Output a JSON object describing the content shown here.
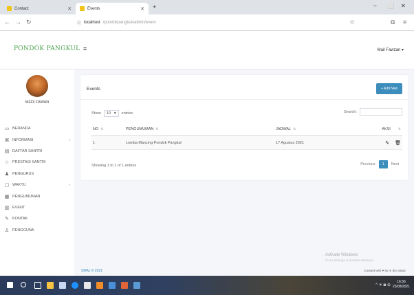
{
  "browser": {
    "tabs": [
      {
        "label": "Contact",
        "active": false
      },
      {
        "label": "Events",
        "active": true
      }
    ],
    "new_tab": "+",
    "url_host": "localhost",
    "url_path": "/pondokpangkul/admin/event",
    "window_controls": {
      "minimize": "–",
      "maximize": "⬜",
      "close": "✕"
    }
  },
  "header": {
    "brand": "PONDOK PANGKUL",
    "user_menu": "Mail Fawzan ▾"
  },
  "sidebar": {
    "user_name": "MEDI FAWAN",
    "items": [
      {
        "icon": "desktop-icon",
        "glyph": "▭",
        "label": "BERANDA",
        "chevron": ""
      },
      {
        "icon": "sitemap-icon",
        "glyph": "⌘",
        "label": "INFORMASI",
        "chevron": "‹"
      },
      {
        "icon": "document-icon",
        "glyph": "▤",
        "label": "DAFTAR SANTRI",
        "chevron": ""
      },
      {
        "icon": "star-icon",
        "glyph": "☆",
        "label": "PRESTASI SANTRI",
        "chevron": ""
      },
      {
        "icon": "users-icon",
        "glyph": "♟",
        "label": "PENGURUS",
        "chevron": ""
      },
      {
        "icon": "book-icon",
        "glyph": "▢",
        "label": "WAKTU",
        "chevron": "‹"
      },
      {
        "icon": "newspaper-icon",
        "glyph": "▦",
        "label": "PENGUMUMAN",
        "chevron": ""
      },
      {
        "icon": "calendar-icon",
        "glyph": "▥",
        "label": "EVENT",
        "chevron": ""
      },
      {
        "icon": "pen-icon",
        "glyph": "✎",
        "label": "KONTAK",
        "chevron": ""
      },
      {
        "icon": "user-icon",
        "glyph": "♙",
        "label": "PENGGUNA",
        "chevron": ""
      }
    ]
  },
  "card": {
    "title": "Events",
    "add_button": "+ Add New",
    "show_label": "Show",
    "show_value": "10",
    "entries_label": "entries",
    "search_label": "Search:",
    "columns": [
      "NO",
      "PENGUMUMAN",
      "JADWAL",
      "AKSI"
    ],
    "rows": [
      {
        "no": "1",
        "pengumuman": "Lomba Mancing Pondok Pangkul",
        "jadwal": "17 Agustus 2021"
      }
    ],
    "info": "Showing 1 to 1 of 1 entries",
    "pager": {
      "previous": "Previous",
      "current": "1",
      "next": "Next"
    }
  },
  "footer": {
    "text": "SMAz © 2021",
    "credit": "Created with ♥ by Ai Ibo Sabar"
  },
  "watermark": {
    "title": "Activate Windows",
    "subtitle": "Go to Settings to activate Windows."
  },
  "taskbar": {
    "time": "16.56",
    "date": "23/08/2021",
    "tray": "^ ☀ ◙ ⊕"
  }
}
